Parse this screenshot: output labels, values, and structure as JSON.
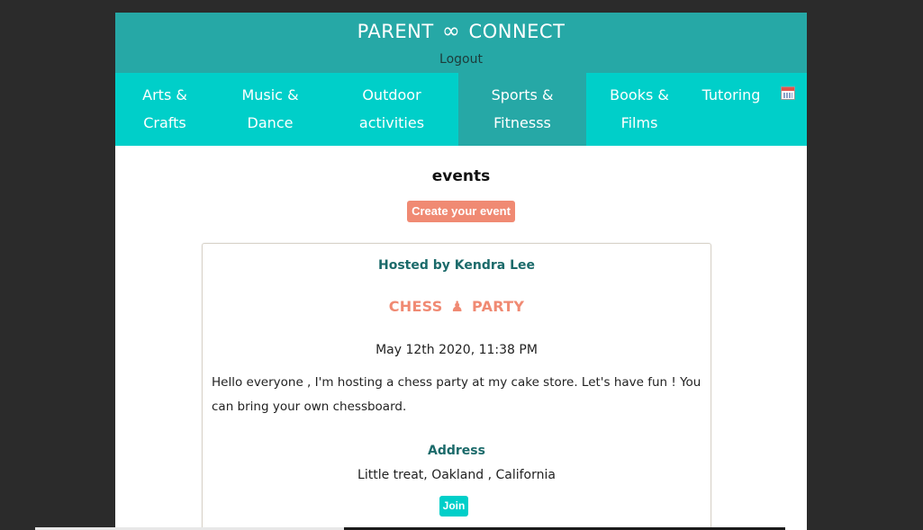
{
  "header": {
    "brand_left": "PARENT",
    "brand_symbol": "∞",
    "brand_right": "CONNECT",
    "logout_label": "Logout"
  },
  "nav": {
    "items": [
      {
        "line1": "Arts &",
        "line2": "Crafts",
        "active": false
      },
      {
        "line1": "Music &",
        "line2": "Dance",
        "active": false
      },
      {
        "line1": "Outdoor",
        "line2": "activities",
        "active": false
      },
      {
        "line1": "Sports &",
        "line2": "Fitnesss",
        "active": true
      },
      {
        "line1": "Books &",
        "line2": "Films",
        "active": false
      },
      {
        "line1": "Tutoring",
        "line2": "",
        "active": false
      }
    ],
    "calendar_icon": "calendar-icon"
  },
  "main": {
    "title": "events",
    "create_button_label": "Create your event"
  },
  "event": {
    "hosted_by": "Hosted by Kendra Lee",
    "title_left": "CHESS",
    "title_icon": "♟",
    "title_right": "PARTY",
    "date": "May 12th 2020, 11:38 PM",
    "description": "Hello everyone , I'm hosting a chess party at my cake store. Let's have fun ! You can bring your own chessboard.",
    "address_label": "Address",
    "address": "Little treat, Oakland , California",
    "join_label": "Join"
  },
  "colors": {
    "header_bg": "#26a8a6",
    "nav_bg": "#00cfc9",
    "accent": "#f08a73",
    "heading_teal": "#1b6a6a"
  }
}
